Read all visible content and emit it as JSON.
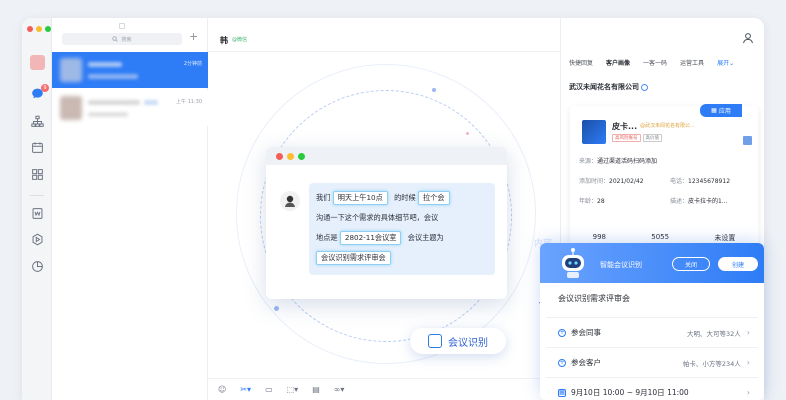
{
  "search": {
    "placeholder": "搜索"
  },
  "sessions": [
    {
      "time": "2分钟前"
    },
    {
      "time": "上午 11:30"
    }
  ],
  "chat": {
    "title": "韩",
    "channel": "@微信"
  },
  "message": {
    "part1": "我们",
    "hl1": "明天上午10点",
    "part2": "的时候",
    "hl2": "拉个会",
    "line2": "沟通一下这个需求的具体细节吧，会议",
    "part3": "地点是",
    "hl3": "2802-11会议室",
    "part4": "会议主题为",
    "hl4": "会议识别需求评审会"
  },
  "meeting_button": {
    "label": "会议识别"
  },
  "right_panel": {
    "tabs": [
      "快捷回复",
      "客户画像",
      "一客一码",
      "运营工具",
      "展开"
    ],
    "active_tab": "客户画像",
    "company": "武汉未闻花名有限公司",
    "apply_label": "应用",
    "customer": {
      "name": "皮卡...",
      "corp": "@武汉未闻花名有限公...",
      "tags": [
        "高风险账号",
        "高价值"
      ],
      "source_label": "来源：",
      "source": "通过渠道活码扫码添加",
      "added_label": "添加时间：",
      "added": "2021/02/42",
      "phone_label": "电话：",
      "phone": "12345678912",
      "age_label": "年龄：",
      "age": "28",
      "desc_label": "描述：",
      "desc": "皮卡拉卡的1...",
      "stats": [
        "998",
        "5055",
        "未设置"
      ]
    }
  },
  "smart_meeting": {
    "title": "智能会议识别",
    "close_label": "关闭",
    "create_label": "创建",
    "topic": "会议识别需求评审会",
    "rows": [
      {
        "key": "参会同事",
        "value": "大明、大可等32人"
      },
      {
        "key": "参会客户",
        "value": "帕卡、小方等234人"
      },
      {
        "key": "9月10日 10:00 ~ 9月10日 11:00",
        "value": ""
      }
    ]
  },
  "colors": {
    "accent": "#2e7cf6",
    "highlight_border": "#8fd0f2",
    "bubble_bg": "#e6f0fd"
  }
}
